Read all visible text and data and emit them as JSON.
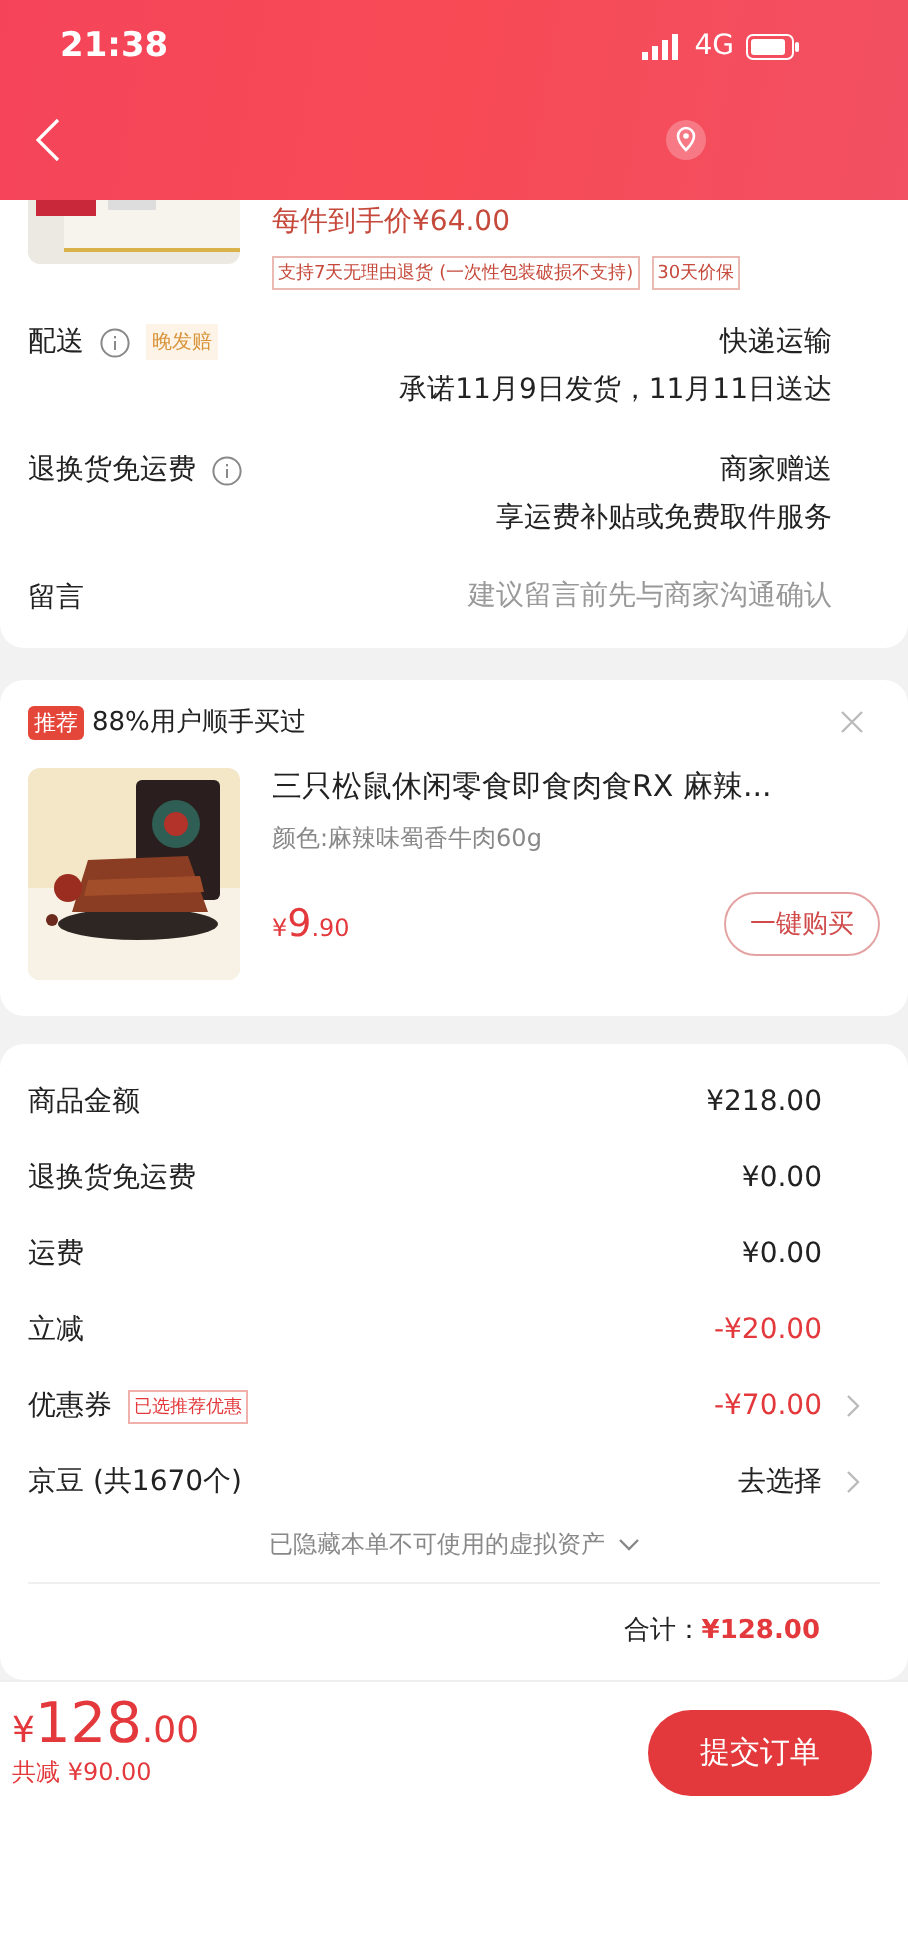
{
  "status_bar": {
    "time": "21:38",
    "network": "4G"
  },
  "order_item": {
    "price_label": "每件到手价¥64.00",
    "tags": [
      "支持7天无理由退货 (一次性包装破损不支持)",
      "30天价保"
    ]
  },
  "service_rows": [
    {
      "label": "配送",
      "info": true,
      "badge": "晚发赔",
      "lines": [
        "快递运输",
        "承诺11月9日发货，11月11日送达"
      ]
    },
    {
      "label": "退换货免运费",
      "info": true,
      "lines": [
        "商家赠送",
        "享运费补贴或免费取件服务"
      ]
    },
    {
      "label": "留言",
      "placeholder": "建议留言前先与商家沟通确认"
    }
  ],
  "recommend": {
    "tag": "推荐",
    "headline": "88%用户顺手买过",
    "title": "三只松鼠休闲零食即食肉食RX 麻辣...",
    "spec": "颜色:麻辣味蜀香牛肉60g",
    "price_symbol": "¥",
    "price_int": "9",
    "price_dec": ".90",
    "button": "一键购买"
  },
  "summary_rows": [
    {
      "label": "商品金额",
      "value": "¥218.00",
      "negative": false,
      "arrow": false
    },
    {
      "label": "退换货免运费",
      "value": "¥0.00",
      "negative": false,
      "arrow": false
    },
    {
      "label": "运费",
      "value": "¥0.00",
      "negative": false,
      "arrow": false
    },
    {
      "label": "立减",
      "value": "-¥20.00",
      "negative": true,
      "arrow": false
    },
    {
      "label": "优惠券",
      "badge": "已选推荐优惠",
      "value": "-¥70.00",
      "negative": true,
      "arrow": true
    },
    {
      "label": "京豆 (共1670个)",
      "value": "去选择",
      "negative": false,
      "arrow": true
    }
  ],
  "hidden_note": "已隐藏本单不可使用的虚拟资产",
  "total": {
    "label": "合计：",
    "value": "¥128.00"
  },
  "bottom_bar": {
    "price_symbol": "¥",
    "price_int": "128",
    "price_dec": ".00",
    "saved": "共减 ¥90.00",
    "submit": "提交订单"
  }
}
